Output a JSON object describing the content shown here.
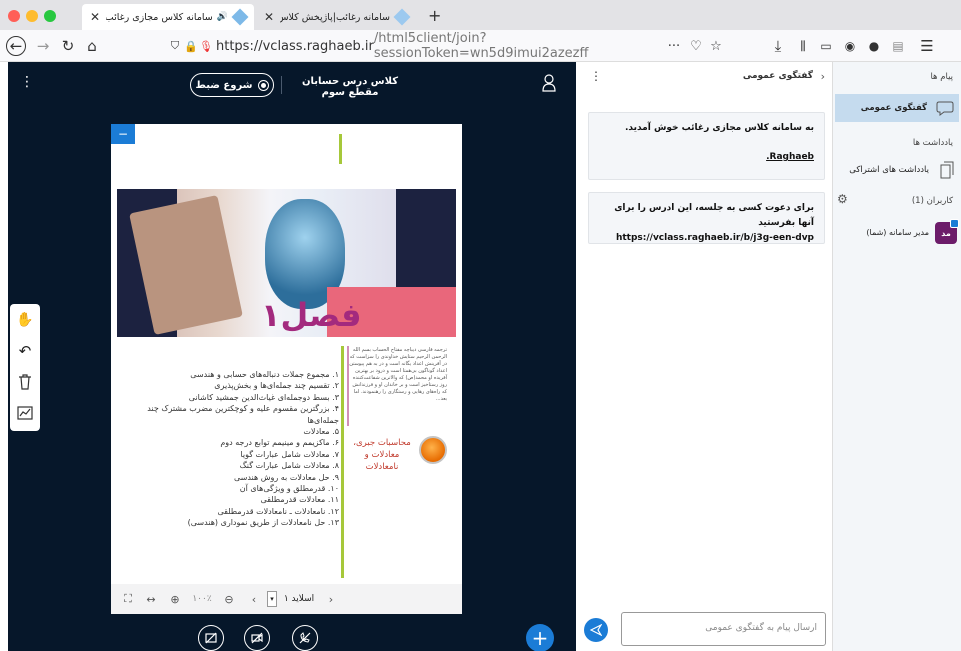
{
  "browser": {
    "tabs": [
      {
        "title": "سامانه کلاس مجازی رغائب - کلاس",
        "active": true
      },
      {
        "title": "سامانه رغائب|پاژپخش کلاس",
        "active": false
      }
    ],
    "new_tab": "+",
    "url_host": "https://vclass.raghaeb.ir",
    "url_rest": "/html5client/join?sessionToken=wn5d9imui2azezff",
    "more": "···"
  },
  "presentation": {
    "meeting_title": "کلاس درس حسابان مقطع سوم",
    "record_label": "شروع ضبط",
    "slide": {
      "chapter": "فصل۱",
      "intro": "ترجمه فارسی دیباچه مفتاح الحساب بسم الله الرحمن الرحیم ستایش خداوندی را سزاست که در آفرینش اعداد یگانه است و در به هم پیوستن اعداد گوناگون بی‌همتا است و درود بر بهترین آفریده او محمد(ص) که والاترین شفاعت‌کننده روز رستاخیز است و بر خاندان او و فرزندانش که راه‌های رهایی و رستگاری را رهنمودند. اما بعد...",
      "subtitle": "محاسبات جبری، معادلات و نامعادلات",
      "items": [
        "۱. مجموع جملات دنباله‌های حسابی و هندسی",
        "۲. تقسیم چند جمله‌ای‌ها و بخش‌پذیری",
        "۳. بسط دوجمله‌ای غیاث‌الدین جمشید کاشانی",
        "۴. بزرگترین مقسوم علیه و کوچکترین مضرب مشترک چند جمله‌ای‌ها",
        "۵. معادلات",
        "۶. ماکزیمم و مینیمم توابع درجه دوم",
        "۷. معادلات شامل عبارات گویا",
        "۸. معادلات شامل عبارات گنگ",
        "۹. حل معادلات به روش هندسی",
        "۱۰. قدرمطلق و ویژگی‌های آن",
        "۱۱. معادلات قدرمطلقی",
        "۱۲. نامعادلات ـ نامعادلات قدرمطلقی",
        "۱۳. حل نامعادلات از طریق نموداری (هندسی)"
      ]
    },
    "toolbar": {
      "zoom": "۱۰۰٪",
      "minus": "⊖",
      "plus": "⊕",
      "slide_label": "اسلاید ۱"
    },
    "minimize": "−",
    "add": "+"
  },
  "chat": {
    "title": "گفتگوی عمومی",
    "welcome": "به سامانه کلاس مجازی رغائب خوش آمدید.",
    "welcome_link": "Raghaeb.",
    "invite": "برای دعوت کسی به جلسه، این ادرس را برای آنها بفرستید",
    "invite_link": "https://vclass.raghaeb.ir/b/j3g-een-dvp",
    "input_placeholder": "ارسال پیام به گفتگوی عمومی"
  },
  "sidebar": {
    "messages_head": "پیام ها",
    "public_chat": "گفتگوی عمومی",
    "notes_head": "یادداشت ها",
    "shared_notes": "یادداشت های اشتراکی",
    "users_head": "کاربران (1)",
    "user_name": "مدیر سامانه (شما)",
    "user_initials": "مد"
  },
  "colors": {
    "accent": "#1b7cd6",
    "presentation_bg": "#06172a",
    "avatar": "#6c1c6a",
    "chapter": "#a32a7e"
  }
}
